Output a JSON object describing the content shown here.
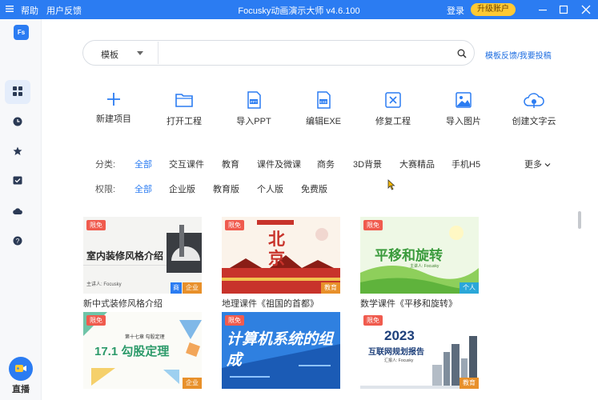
{
  "titlebar": {
    "menu_help": "帮助",
    "menu_feedback": "用户反馈",
    "title": "Focusky动画演示大师 v4.6.100",
    "login": "登录",
    "upgrade": "升级账户"
  },
  "sidebar": {
    "logo": "Fs",
    "items": [
      {
        "icon": "grid-icon",
        "active": true
      },
      {
        "icon": "clock-icon",
        "active": false
      },
      {
        "icon": "star-icon",
        "active": false
      },
      {
        "icon": "checkbox-icon",
        "active": false
      },
      {
        "icon": "cloud-icon",
        "active": false
      },
      {
        "icon": "help-icon",
        "active": false
      }
    ],
    "live_label": "直播"
  },
  "search": {
    "category": "模板",
    "placeholder": "",
    "feedback_link": "模板反馈/我要投稿"
  },
  "actions": [
    {
      "label": "新建项目",
      "icon": "plus-icon"
    },
    {
      "label": "打开工程",
      "icon": "folder-icon"
    },
    {
      "label": "导入PPT",
      "icon": "ppt-file-icon"
    },
    {
      "label": "编辑EXE",
      "icon": "exe-file-icon"
    },
    {
      "label": "修复工程",
      "icon": "repair-icon"
    },
    {
      "label": "导入图片",
      "icon": "image-icon"
    },
    {
      "label": "创建文字云",
      "icon": "word-cloud-icon"
    }
  ],
  "filters": {
    "category_title": "分类:",
    "category_options": [
      "全部",
      "交互课件",
      "教育",
      "课件及微课",
      "商务",
      "3D背景",
      "大赛精品",
      "手机H5"
    ],
    "more": "更多",
    "permission_title": "权限:",
    "permission_options": [
      "全部",
      "企业版",
      "教育版",
      "个人版",
      "免费版"
    ]
  },
  "cards": [
    {
      "title": "新中式装修风格介绍",
      "free": "限免",
      "category": "企业",
      "shop": "商",
      "inner_title": "室内装修风格介绍",
      "inner_author": "主讲人: Focusky"
    },
    {
      "title": "地理课件《祖国的首都》",
      "free": "限免",
      "category": "教育",
      "inner_title": "北京"
    },
    {
      "title": "数学课件《平移和旋转》",
      "free": "限免",
      "category": "个人",
      "inner_title": "平移和旋转",
      "inner_author": "主讲人: Focusky"
    },
    {
      "title": "",
      "free": "限免",
      "category": "企业",
      "inner_title": "17.1 勾股定理",
      "inner_subtitle": "第十七章 勾股定理"
    },
    {
      "title": "",
      "free": "限免",
      "category": "",
      "inner_title": "计算机系统的组成"
    },
    {
      "title": "",
      "free": "限免",
      "category": "教育",
      "inner_title": "2023",
      "inner_subtitle": "互联网规划报告",
      "inner_author": "汇报人: Focusky"
    }
  ],
  "colors": {
    "brand": "#2b7cf2",
    "upgrade": "#ffc933",
    "free_badge": "#f05b4e"
  }
}
